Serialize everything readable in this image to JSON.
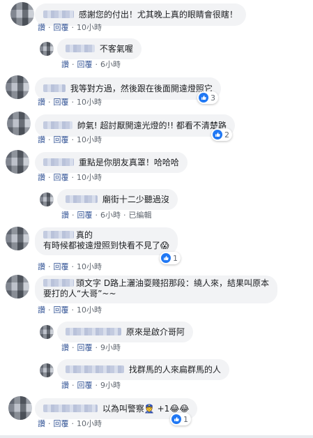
{
  "actions": {
    "like": "讚",
    "reply": "回覆",
    "edited": "已編輯"
  },
  "comments": [
    {
      "text": "感謝您的付出！尤其晚上真的眼睛會很瞎！",
      "time": "10小時"
    },
    {
      "text": "不客氣喔",
      "time": "6小時"
    },
    {
      "text": "我等對方過，然後跟在後面開遠燈照它",
      "time": "10小時",
      "reactions": "3"
    },
    {
      "text": "帥氣! 超討厭開遠光燈的!! 都看不清楚路",
      "time": "10小時",
      "reactions": "2"
    },
    {
      "text": "重點是你朋友真罩！哈哈哈",
      "time": "10小時"
    },
    {
      "text": "廟街十二少聽過沒",
      "time": "6小時"
    },
    {
      "text_line1": "真的",
      "text_line2": "有時候都被遠燈照到快看不見了",
      "time": "10小時",
      "reactions": "1"
    },
    {
      "text_line1": "頭文字 D路上灑油耍賤招那段：繞人來，結果叫原本",
      "text_line2": "要打的人“大哥”~~",
      "time": "10小時"
    },
    {
      "text": "原來是啟介哥阿",
      "time": "9小時"
    },
    {
      "text": "找群馬的人來扁群馬的人",
      "time": "9小時"
    },
    {
      "text": "以為叫警察",
      "suffix": "+1",
      "time": "10小時",
      "reactions": "1"
    }
  ]
}
